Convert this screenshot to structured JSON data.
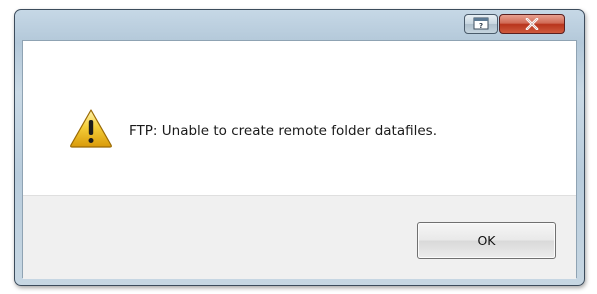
{
  "window": {
    "title": ""
  },
  "titlebar": {
    "help_icon": "help-icon",
    "close_icon": "close-icon"
  },
  "dialog": {
    "icon": "warning-icon",
    "message": "FTP: Unable to create remote folder datafiles.",
    "ok_label": "OK"
  },
  "colors": {
    "close_button": "#c8462a",
    "warning_yellow": "#f2c224",
    "frame": "#b8ccdc"
  }
}
